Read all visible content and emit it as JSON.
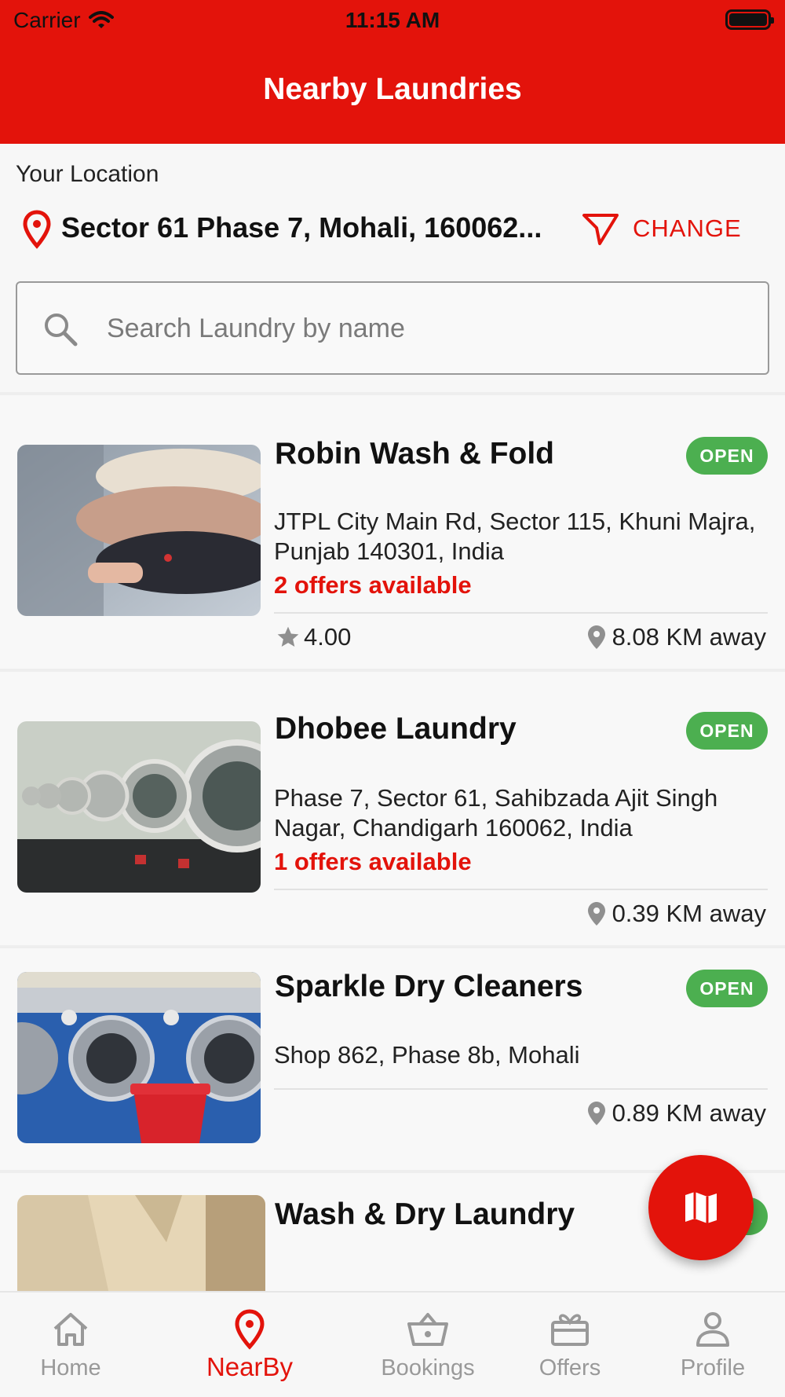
{
  "status_bar": {
    "carrier": "Carrier",
    "time": "11:15 AM"
  },
  "header": {
    "title": "Nearby Laundries"
  },
  "location": {
    "label": "Your Location",
    "address": "Sector 61 Phase 7, Mohali, 160062...",
    "change_label": "CHANGE"
  },
  "search": {
    "placeholder": "Search Laundry by name"
  },
  "laundries": [
    {
      "name": "Robin Wash & Fold",
      "status": "OPEN",
      "address": "JTPL City Main Rd, Sector 115, Khuni Majra, Punjab 140301, India",
      "offers": "2 offers available",
      "rating": "4.00",
      "distance": "8.08 KM away"
    },
    {
      "name": "Dhobee Laundry",
      "status": "OPEN",
      "address": "Phase 7, Sector 61, Sahibzada Ajit Singh Nagar, Chandigarh 160062, India",
      "offers": "1 offers available",
      "distance": "0.39 KM away"
    },
    {
      "name": "Sparkle Dry Cleaners",
      "status": "OPEN",
      "address": "Shop 862, Phase 8b, Mohali",
      "distance": "0.89 KM away"
    },
    {
      "name": "Wash & Dry Laundry",
      "status": "OPEN"
    }
  ],
  "nav": {
    "items": [
      {
        "label": "Home",
        "icon": "home-icon"
      },
      {
        "label": "NearBy",
        "icon": "location-pin-icon",
        "active": true
      },
      {
        "label": "Bookings",
        "icon": "basket-icon"
      },
      {
        "label": "Offers",
        "icon": "gift-icon"
      },
      {
        "label": "Profile",
        "icon": "person-icon"
      }
    ]
  },
  "colors": {
    "brand": "#e3130b",
    "open_badge": "#4caf50",
    "inactive_nav": "#999999"
  }
}
